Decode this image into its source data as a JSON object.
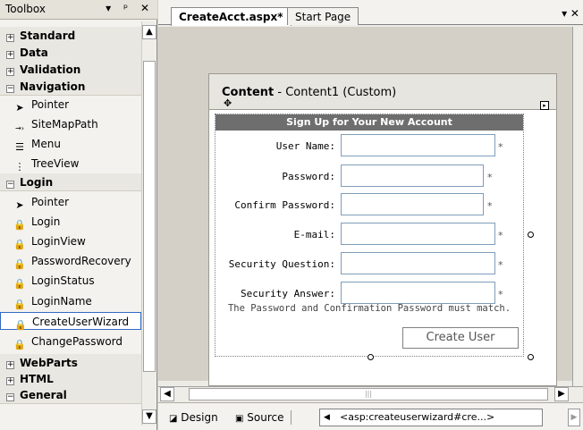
{
  "toolbox": {
    "title": "Toolbox",
    "title_buttons": "▾ ᵖ ✕",
    "categories_top": [
      {
        "label": "Standard",
        "state": "+"
      },
      {
        "label": "Data",
        "state": "+"
      },
      {
        "label": "Validation",
        "state": "+"
      },
      {
        "label": "Navigation",
        "state": "−"
      }
    ],
    "nav_items": [
      {
        "label": "Pointer",
        "icon": "pointer-icon"
      },
      {
        "label": "SiteMapPath",
        "icon": "sitemap-icon"
      },
      {
        "label": "Menu",
        "icon": "menu-icon"
      },
      {
        "label": "TreeView",
        "icon": "treeview-icon"
      }
    ],
    "login_category": {
      "label": "Login",
      "state": "−"
    },
    "login_items": [
      {
        "label": "Pointer",
        "icon": "pointer-icon"
      },
      {
        "label": "Login",
        "icon": "login-icon"
      },
      {
        "label": "LoginView",
        "icon": "loginview-icon"
      },
      {
        "label": "PasswordRecovery",
        "icon": "passwordrecovery-icon"
      },
      {
        "label": "LoginStatus",
        "icon": "loginstatus-icon"
      },
      {
        "label": "LoginName",
        "icon": "loginname-icon"
      },
      {
        "label": "CreateUserWizard",
        "icon": "createuserwizard-icon",
        "selected": true
      },
      {
        "label": "ChangePassword",
        "icon": "changepassword-icon"
      }
    ],
    "categories_bottom": [
      {
        "label": "WebParts",
        "state": "+"
      },
      {
        "label": "HTML",
        "state": "+"
      },
      {
        "label": "General",
        "state": "−"
      }
    ]
  },
  "editor": {
    "tabs": [
      {
        "label": "CreateAcct.aspx*",
        "active": true
      },
      {
        "label": "Start Page",
        "active": false
      }
    ],
    "content_placeholder": {
      "name": "Content",
      "suffix": " - Content1 (Custom)"
    },
    "wizard": {
      "title": "Sign Up for Your New Account",
      "fields": [
        {
          "label": "User Name:"
        },
        {
          "label": "Password:"
        },
        {
          "label": "Confirm Password:"
        },
        {
          "label": "E-mail:"
        },
        {
          "label": "Security Question:"
        },
        {
          "label": "Security Answer:"
        }
      ],
      "required_mark": "*",
      "error_message": "The Password and Confirmation Password must match.",
      "create_button": "Create User"
    },
    "view_tabs": {
      "design": "Design",
      "source": "Source"
    },
    "breadcrumb": "<asp:createuserwizard#cre...>"
  }
}
